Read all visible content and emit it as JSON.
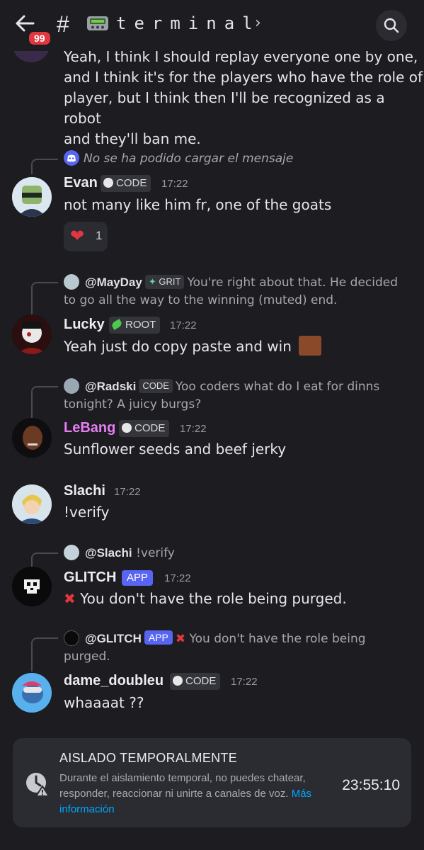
{
  "header": {
    "back_icon": "arrow-left-icon",
    "badge_count": "99",
    "hash": "#",
    "channel_emoji": "pager-icon",
    "channel_name": "terminal",
    "chevron": "›",
    "search_icon": "search-icon"
  },
  "top_message": {
    "lines": [
      "Yeah, I think I should replay everyone one by one,",
      "and I think it's for the players who have the role of",
      "player, but I think then I'll be recognized as a robot",
      "and they'll ban me."
    ]
  },
  "messages": [
    {
      "reply": {
        "failed_text": "No se ha podido cargar el mensaje"
      },
      "author": "Evan",
      "tag": "CODE",
      "time": "17:22",
      "text": "not many like him fr, one of the goats",
      "reaction": {
        "emoji": "❤",
        "count": "1"
      }
    },
    {
      "reply": {
        "name": "@MayDay",
        "tag": "GRIT",
        "text": "You're right about that. He decided to go all the way to the winning (muted) end."
      },
      "author": "Lucky",
      "tag": "ROOT",
      "time": "17:22",
      "text": "Yeah just do copy paste and win"
    },
    {
      "reply": {
        "name": "@Radski",
        "tag": "CODE",
        "text": "Yoo coders what do I eat for dinns tonight? A juicy burgs?"
      },
      "author": "LeBang",
      "tag": "CODE",
      "time": "17:22",
      "text": "Sunflower seeds and beef jerky"
    },
    {
      "author": "Slachi",
      "time": "17:22",
      "text": "!verify"
    },
    {
      "reply": {
        "name": "@Slachi",
        "text": "!verify"
      },
      "author": "GLITCH",
      "tag": "APP",
      "time": "17:22",
      "text": "You don't have the role being purged."
    },
    {
      "reply": {
        "name": "@GLITCH",
        "tag": "APP",
        "text": "You don't have the role being purged."
      },
      "author": "dame_doubleu",
      "tag": "CODE",
      "time": "17:22",
      "text": "whaaaat ??"
    }
  ],
  "timeout_banner": {
    "title": "AISLADO TEMPORALMENTE",
    "description": "Durante el aislamiento temporal, no puedes chatear, responder, reaccionar ni unirte a canales de voz.",
    "link": "Más información",
    "countdown": "23:55:10"
  },
  "colors": {
    "background": "#1c1c21",
    "lebang_name": "#e57ef0",
    "app_badge": "#5865f2",
    "root_icon": "#4ec94e",
    "grit_icon": "#5fd39a",
    "link": "#00a8fc"
  }
}
